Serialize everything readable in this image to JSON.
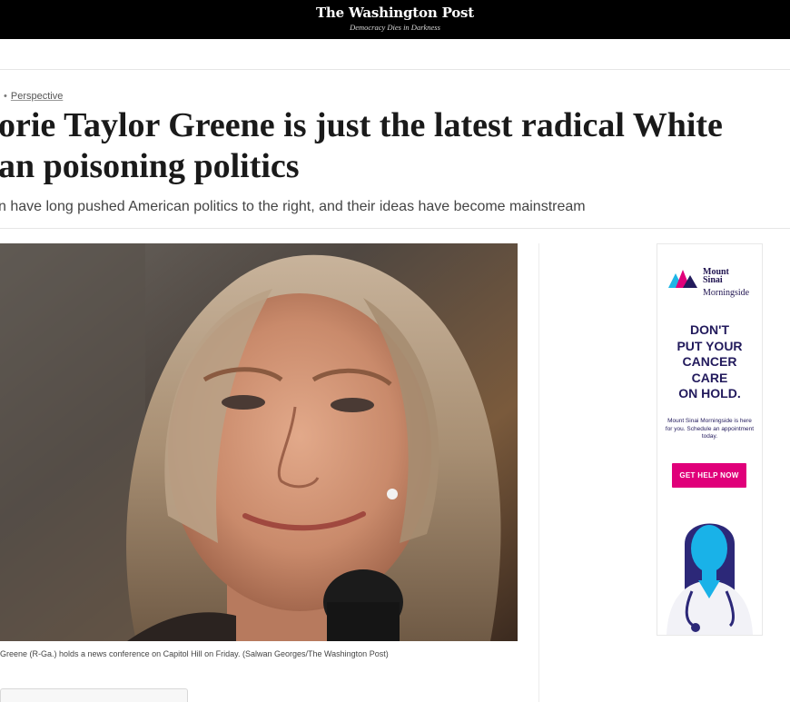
{
  "masthead": {
    "title": "The Washington Post",
    "tagline": "Democracy Dies in Darkness"
  },
  "article": {
    "kicker": "Perspective",
    "headline_line1": "orie Taylor Greene is just the latest radical White",
    "headline_line2": "an poisoning politics",
    "dek": "n have long pushed American politics to the right, and their ideas have become mainstream",
    "caption": "Greene (R-Ga.) holds a news conference on Capitol Hill on Friday. (Salwan Georges/The Washington Post)"
  },
  "ad": {
    "adchoices_icon": "adchoices-icon",
    "logo_line1": "Mount",
    "logo_line2": "Sinai",
    "logo_line3": "Morningside",
    "headline_line1": "DON'T",
    "headline_line2": "PUT YOUR",
    "headline_line3": "CANCER",
    "headline_line4": "CARE",
    "headline_line5": "ON HOLD.",
    "body": "Mount Sinai Morningside is here for you. Schedule an appointment today.",
    "cta": "GET HELP NOW",
    "colors": {
      "navy": "#221a5c",
      "magenta": "#e0007a",
      "cyan": "#1fb6e6"
    }
  }
}
